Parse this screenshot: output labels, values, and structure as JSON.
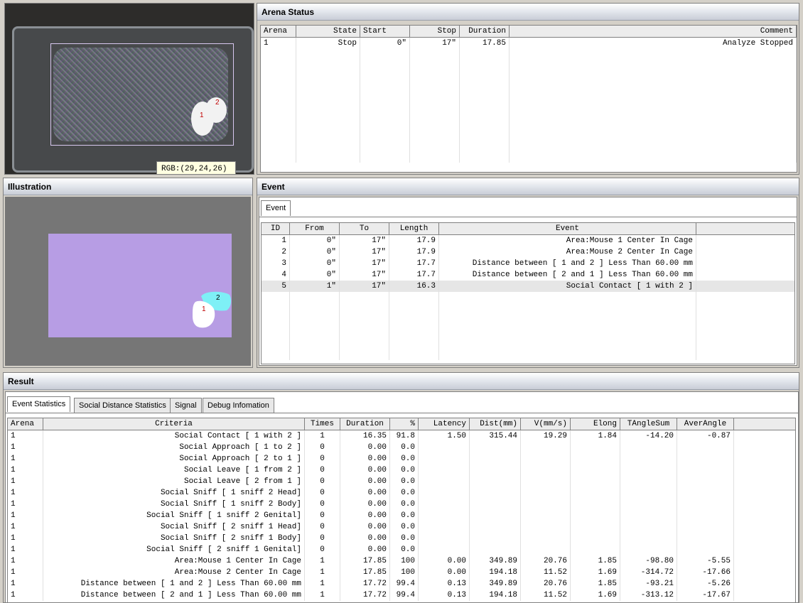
{
  "video": {
    "rgb_readout": "RGB:(29,24,26)",
    "mouse1": "1",
    "mouse2": "2"
  },
  "arena_status": {
    "title": "Arena Status",
    "columns": [
      "Arena",
      "State",
      "Start",
      "Stop",
      "Duration",
      "Comment"
    ],
    "rows": [
      [
        "1",
        "Stop",
        "0\"",
        "17\"",
        "17.85",
        "Analyze Stopped"
      ]
    ]
  },
  "illustration": {
    "title": "Illustration",
    "mouse1": "1",
    "mouse2": "2"
  },
  "event": {
    "title": "Event",
    "tab": "Event",
    "columns": [
      "ID",
      "From",
      "To",
      "Length",
      "Event"
    ],
    "rows": [
      [
        "1",
        "0\"",
        "17\"",
        "17.9",
        "Area:Mouse 1 Center In Cage"
      ],
      [
        "2",
        "0\"",
        "17\"",
        "17.9",
        "Area:Mouse 2 Center In Cage"
      ],
      [
        "3",
        "0\"",
        "17\"",
        "17.7",
        "Distance between [ 1 and 2 ] Less Than  60.00 mm"
      ],
      [
        "4",
        "0\"",
        "17\"",
        "17.7",
        "Distance between [ 2 and 1 ] Less Than  60.00 mm"
      ],
      [
        "5",
        "1\"",
        "17\"",
        "16.3",
        "Social Contact [ 1 with 2 ]"
      ]
    ]
  },
  "result": {
    "title": "Result",
    "tabs": [
      "Event Statistics",
      "Social Distance Statistics",
      "Signal",
      "Debug Infomation"
    ],
    "columns": [
      "Arena",
      "Criteria",
      "Times",
      "Duration",
      "%",
      "Latency",
      "Dist(mm)",
      "V(mm/s)",
      "Elong",
      "TAngleSum",
      "AverAngle"
    ],
    "rows": [
      [
        "1",
        "Social Contact [ 1 with 2 ]",
        "1",
        "16.35",
        "91.8",
        "1.50",
        "315.44",
        "19.29",
        "1.84",
        "-14.20",
        "-0.87"
      ],
      [
        "1",
        "Social Approach [ 1 to 2 ]",
        "0",
        "0.00",
        "0.0",
        "",
        "",
        "",
        "",
        "",
        ""
      ],
      [
        "1",
        "Social Approach [ 2 to 1 ]",
        "0",
        "0.00",
        "0.0",
        "",
        "",
        "",
        "",
        "",
        ""
      ],
      [
        "1",
        "Social Leave [ 1 from 2 ]",
        "0",
        "0.00",
        "0.0",
        "",
        "",
        "",
        "",
        "",
        ""
      ],
      [
        "1",
        "Social Leave [ 2 from 1 ]",
        "0",
        "0.00",
        "0.0",
        "",
        "",
        "",
        "",
        "",
        ""
      ],
      [
        "1",
        "Social Sniff [ 1 sniff 2  Head]",
        "0",
        "0.00",
        "0.0",
        "",
        "",
        "",
        "",
        "",
        ""
      ],
      [
        "1",
        "Social Sniff [ 1 sniff 2  Body]",
        "0",
        "0.00",
        "0.0",
        "",
        "",
        "",
        "",
        "",
        ""
      ],
      [
        "1",
        "Social Sniff [ 1 sniff 2  Genital]",
        "0",
        "0.00",
        "0.0",
        "",
        "",
        "",
        "",
        "",
        ""
      ],
      [
        "1",
        "Social Sniff [ 2 sniff 1  Head]",
        "0",
        "0.00",
        "0.0",
        "",
        "",
        "",
        "",
        "",
        ""
      ],
      [
        "1",
        "Social Sniff [ 2 sniff 1  Body]",
        "0",
        "0.00",
        "0.0",
        "",
        "",
        "",
        "",
        "",
        ""
      ],
      [
        "1",
        "Social Sniff [ 2 sniff 1  Genital]",
        "0",
        "0.00",
        "0.0",
        "",
        "",
        "",
        "",
        "",
        ""
      ],
      [
        "1",
        "Area:Mouse 1 Center In Cage",
        "1",
        "17.85",
        "100",
        "0.00",
        "349.89",
        "20.76",
        "1.85",
        "-98.80",
        "-5.55"
      ],
      [
        "1",
        "Area:Mouse 2 Center In Cage",
        "1",
        "17.85",
        "100",
        "0.00",
        "194.18",
        "11.52",
        "1.69",
        "-314.72",
        "-17.66"
      ],
      [
        "1",
        "Distance between [ 1 and 2 ] Less Than  60.00 mm",
        "1",
        "17.72",
        "99.4",
        "0.13",
        "349.89",
        "20.76",
        "1.85",
        "-93.21",
        "-5.26"
      ],
      [
        "1",
        "Distance between [ 2 and 1 ] Less Than  60.00 mm",
        "1",
        "17.72",
        "99.4",
        "0.13",
        "194.18",
        "11.52",
        "1.69",
        "-313.12",
        "-17.67"
      ]
    ]
  }
}
